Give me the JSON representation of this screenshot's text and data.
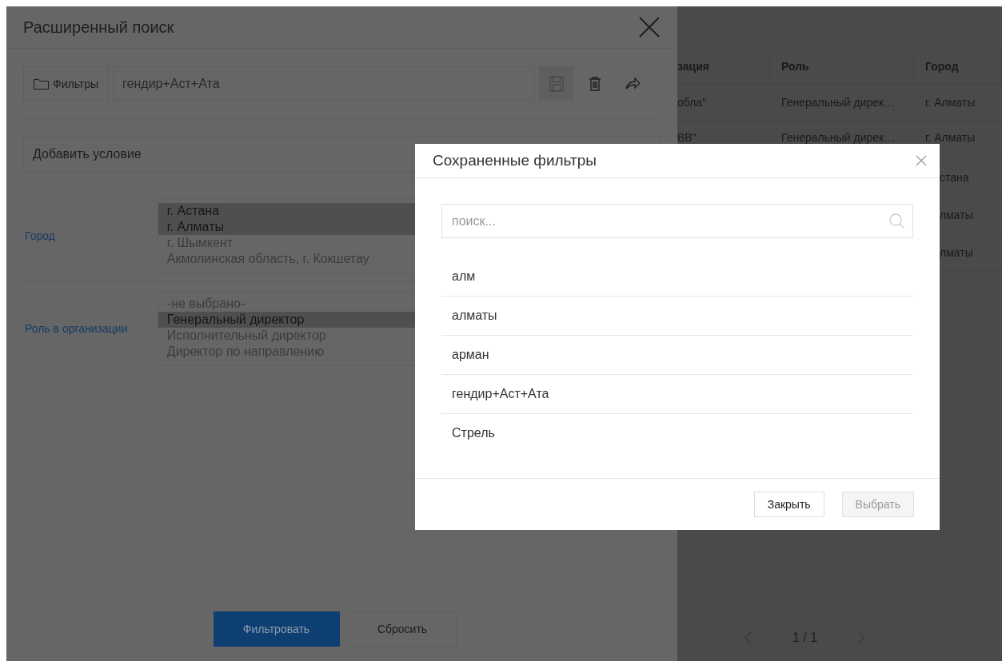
{
  "search_panel": {
    "title": "Расширенный поиск",
    "filters_button": "Фильтры",
    "filter_name": "гендир+Аст+Ата",
    "add_condition": "Добавить условие",
    "conditions": [
      {
        "label": "Город",
        "options": [
          {
            "text": "г. Астана",
            "selected": true
          },
          {
            "text": "г. Алматы",
            "selected": true
          },
          {
            "text": "г. Шымкент",
            "selected": false
          },
          {
            "text": "Акмолинская область, г. Кокшетау",
            "selected": false
          }
        ]
      },
      {
        "label": "Роль в организации",
        "options": [
          {
            "text": "-не выбрано-",
            "selected": false
          },
          {
            "text": "Генеральный директор",
            "selected": true
          },
          {
            "text": "Исполнительный директор",
            "selected": false
          },
          {
            "text": "Директор по направлению",
            "selected": false
          }
        ]
      }
    ],
    "buttons": [
      {
        "label": "Фильтровать",
        "kind": "primary"
      },
      {
        "label": "Сбросить",
        "kind": "default"
      }
    ]
  },
  "results_table": {
    "columns": [
      "зация",
      "Роль",
      "Город"
    ],
    "rows": [
      {
        "cells": [
          "обла\"",
          "Генеральный дирек…",
          "г. Алматы"
        ]
      },
      {
        "cells": [
          "ВВ\"",
          "Генеральный дирек…",
          "г. Алматы"
        ]
      },
      {
        "cells": [
          null,
          null,
          "стана"
        ]
      },
      {
        "cells": [
          null,
          null,
          "лматы"
        ]
      },
      {
        "cells": [
          null,
          null,
          "лматы"
        ]
      }
    ],
    "pagination": "1 / 1"
  },
  "saved_filters": {
    "title": "Сохраненные фильтры",
    "search_placeholder": "поиск...",
    "items": [
      "алм",
      "алматы",
      "арман",
      "гендир+Аст+Ата",
      "Стрель"
    ],
    "buttons": [
      {
        "label": "Закрыть",
        "disabled": false
      },
      {
        "label": "Выбрать",
        "disabled": true
      }
    ]
  }
}
